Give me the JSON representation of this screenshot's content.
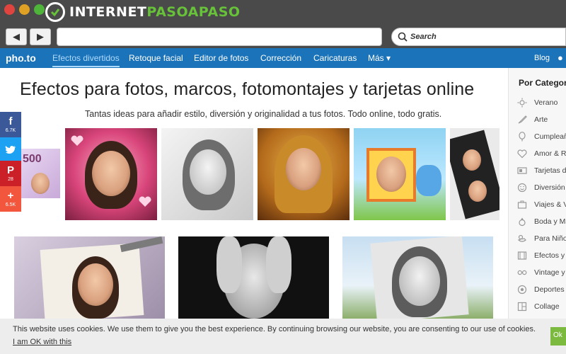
{
  "window": {
    "brand_prefix": "INTERNET",
    "brand_accent": "PASOAPASO",
    "search_placeholder": "Search",
    "back_glyph": "◀",
    "forward_glyph": "▶"
  },
  "nav": {
    "logo": "pho.to",
    "items": [
      {
        "label": "Efectos divertidos",
        "active": true
      },
      {
        "label": "Retoque facial"
      },
      {
        "label": "Editor de fotos"
      },
      {
        "label": "Corrección"
      },
      {
        "label": "Caricaturas"
      },
      {
        "label": "Más ▾"
      }
    ],
    "blog": "Blog"
  },
  "main": {
    "title": "Efectos para fotos, marcos, fotomontajes y tarjetas online",
    "subtitle": "Tantas ideas para añadir estilo, diversión y originalidad a tus fotos. Todo online, todo gratis.",
    "banknote_value": "500"
  },
  "share": [
    {
      "icon": "facebook-icon",
      "glyph": "f",
      "count": "6.7K",
      "color": "#3b5998"
    },
    {
      "icon": "twitter-icon",
      "glyph": "t",
      "count": "",
      "color": "#1da1f2"
    },
    {
      "icon": "pinterest-icon",
      "glyph": "P",
      "count": "28",
      "color": "#cb2027"
    },
    {
      "icon": "plus-icon",
      "glyph": "+",
      "count": "6.5K",
      "color": "#f2573d"
    }
  ],
  "sidebar": {
    "title": "Por Categoría",
    "items": [
      {
        "label": "Verano",
        "icon": "sun-icon"
      },
      {
        "label": "Arte",
        "icon": "brush-icon"
      },
      {
        "label": "Cumpleaños",
        "icon": "balloon-icon"
      },
      {
        "label": "Amor & Ro",
        "icon": "heart-icon"
      },
      {
        "label": "Tarjetas de",
        "icon": "card-icon"
      },
      {
        "label": "Diversión y",
        "icon": "smiley-icon"
      },
      {
        "label": "Viajes & Va",
        "icon": "suitcase-icon"
      },
      {
        "label": "Boda y Ma",
        "icon": "ring-icon"
      },
      {
        "label": "Para Niños",
        "icon": "duck-icon"
      },
      {
        "label": "Efectos y F",
        "icon": "film-icon"
      },
      {
        "label": "Vintage y F",
        "icon": "glasses-icon"
      },
      {
        "label": "Deportes",
        "icon": "ball-icon"
      },
      {
        "label": "Collage",
        "icon": "collage-icon"
      }
    ]
  },
  "cookie": {
    "text": "This website uses cookies. We use them to give you the best experience. By continuing browsing our website, you are consenting to our use of cookies.",
    "link": "I am OK with this",
    "button": "Ok"
  }
}
